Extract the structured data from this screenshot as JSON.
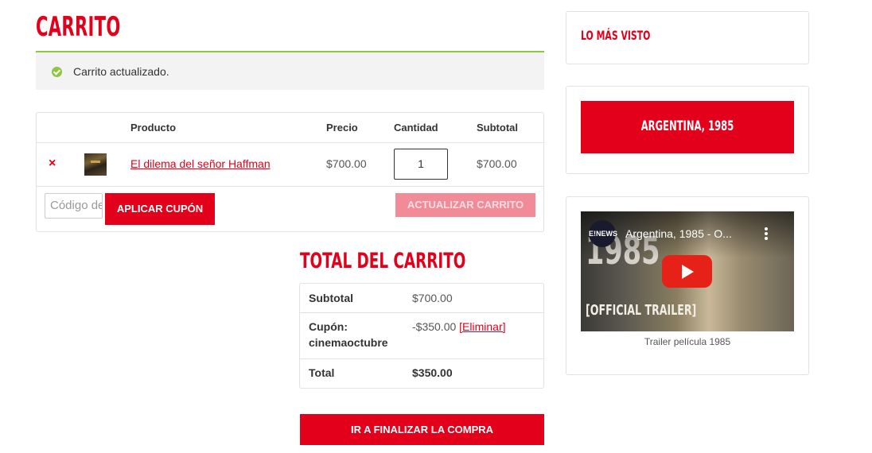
{
  "page": {
    "title": "CARRITO"
  },
  "notice": {
    "message": "Carrito actualizado."
  },
  "cart": {
    "headers": {
      "product": "Producto",
      "price": "Precio",
      "quantity": "Cantidad",
      "subtotal": "Subtotal"
    },
    "items": [
      {
        "remove": "×",
        "name": "El dilema del señor Haffman",
        "price": "$700.00",
        "quantity": "1",
        "subtotal": "$700.00"
      }
    ],
    "coupon_placeholder": "Código de cupón",
    "apply_coupon_label": "APLICAR CUPÓN",
    "update_cart_label": "ACTUALIZAR CARRITO"
  },
  "totals": {
    "title": "TOTAL DEL CARRITO",
    "subtotal_label": "Subtotal",
    "subtotal_value": "$700.00",
    "coupon_label": "Cupón: cinemaoctubre",
    "coupon_value": "-$350.00",
    "coupon_remove": "[Eliminar]",
    "total_label": "Total",
    "total_value": "$350.00",
    "checkout_label": "IR A FINALIZAR LA COMPRA"
  },
  "sidebar": {
    "most_viewed_title": "LO MÁS VISTO",
    "featured_button": "ARGENTINA, 1985",
    "video": {
      "channel": "E!NEWS",
      "title": "Argentina, 1985 - O...",
      "overlay_big": "1985",
      "overlay_bottom": "[OFFICIAL TRAILER]",
      "caption": "Trailer película 1985"
    }
  },
  "colors": {
    "accent": "#e2001a",
    "success": "#8dc63f",
    "disabled": "#f08b97"
  }
}
